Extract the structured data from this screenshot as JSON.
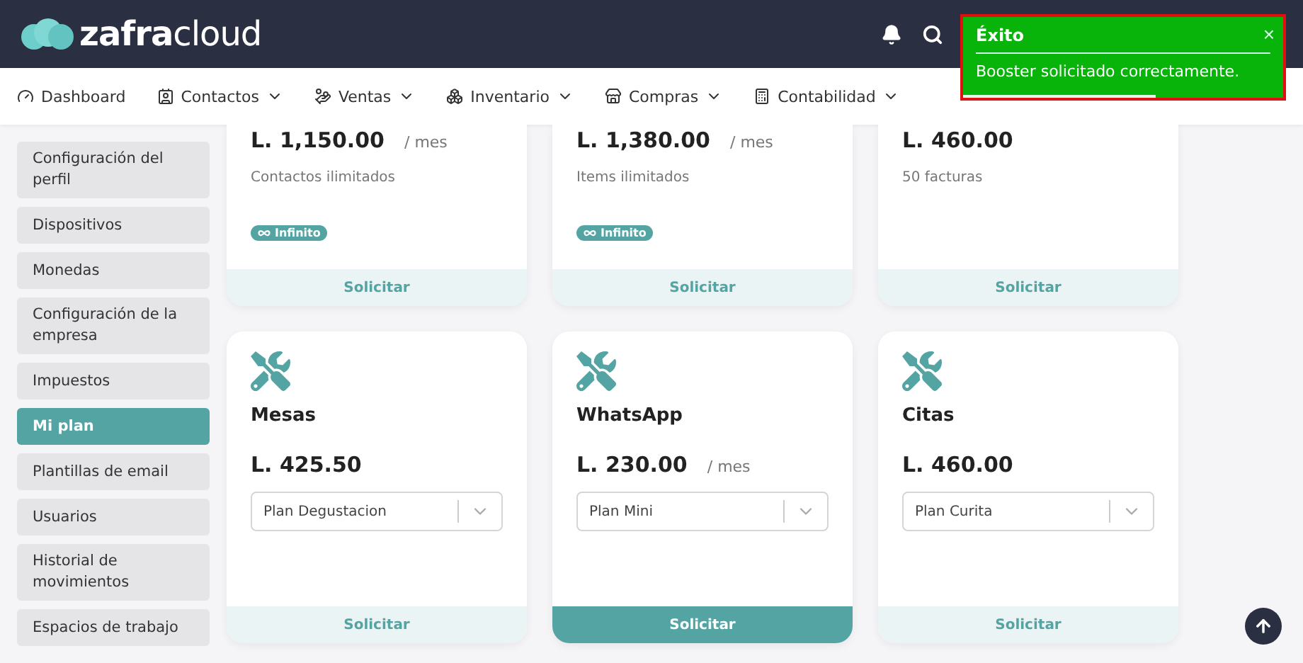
{
  "header": {
    "logo_bold": "zafra",
    "logo_light": "cloud"
  },
  "nav": [
    {
      "label": "Dashboard",
      "dropdown": false
    },
    {
      "label": "Contactos",
      "dropdown": true
    },
    {
      "label": "Ventas",
      "dropdown": true
    },
    {
      "label": "Inventario",
      "dropdown": true
    },
    {
      "label": "Compras",
      "dropdown": true
    },
    {
      "label": "Contabilidad",
      "dropdown": true
    }
  ],
  "sidebar": {
    "items": [
      {
        "label": "Configuración del perfil",
        "selected": false
      },
      {
        "label": "Dispositivos",
        "selected": false
      },
      {
        "label": "Monedas",
        "selected": false
      },
      {
        "label": "Configuración de la empresa",
        "selected": false
      },
      {
        "label": "Impuestos",
        "selected": false
      },
      {
        "label": "Mi plan",
        "selected": true
      },
      {
        "label": "Plantillas de email",
        "selected": false
      },
      {
        "label": "Usuarios",
        "selected": false
      },
      {
        "label": "Historial de movimientos",
        "selected": false
      },
      {
        "label": "Espacios de trabajo",
        "selected": false
      }
    ]
  },
  "top_cards": [
    {
      "price": "L. 1,150.00",
      "period": "/ mes",
      "description": "Contactos ilimitados",
      "badge": "Infinito",
      "button": "Solicitar",
      "selected": false
    },
    {
      "price": "L. 1,380.00",
      "period": "/ mes",
      "description": "Items ilimitados",
      "badge": "Infinito",
      "button": "Solicitar",
      "selected": false
    },
    {
      "price": "L. 460.00",
      "description": "50 facturas",
      "button": "Solicitar",
      "selected": false
    }
  ],
  "cards": [
    {
      "title": "Mesas",
      "price": "L. 425.50",
      "plan": "Plan Degustacion",
      "button": "Solicitar",
      "selected": false
    },
    {
      "title": "WhatsApp",
      "price": "L. 230.00",
      "period": "/ mes",
      "plan": "Plan Mini",
      "button": "Solicitar",
      "selected": true
    },
    {
      "title": "Citas",
      "price": "L. 460.00",
      "plan": "Plan Curita",
      "button": "Solicitar",
      "selected": false
    }
  ],
  "toast": {
    "title": "Éxito",
    "message": "Booster solicitado correctamente.",
    "close": "×",
    "level": 0.6
  }
}
